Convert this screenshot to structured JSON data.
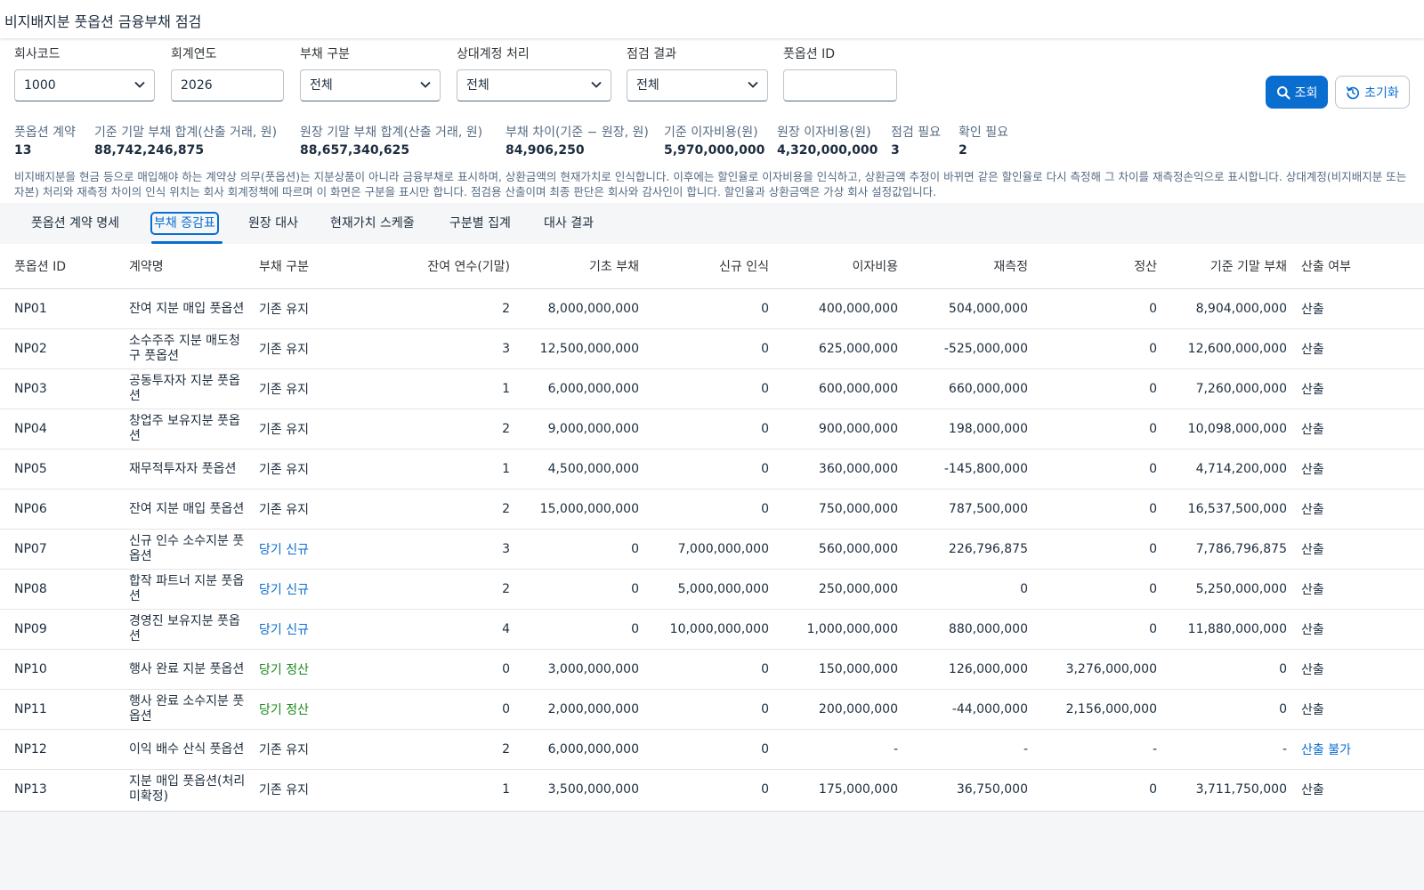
{
  "app": {
    "title": "비지배지분 풋옵션 금융부채 점검"
  },
  "filters": {
    "company": {
      "label": "회사코드",
      "value": "1000"
    },
    "year": {
      "label": "회계연도",
      "value": "2026"
    },
    "category": {
      "label": "부채 구분",
      "value": "전체"
    },
    "counter": {
      "label": "상대계정 처리",
      "value": "전체"
    },
    "result": {
      "label": "점검 결과",
      "value": "전체"
    },
    "putid": {
      "label": "풋옵션 ID",
      "value": ""
    }
  },
  "buttons": {
    "search": "조회",
    "reset": "초기화"
  },
  "kpis": [
    {
      "label": "풋옵션 계약",
      "value": "13"
    },
    {
      "label": "기준 기말 부채 합계(산출 거래, 원)",
      "value": "88,742,246,875"
    },
    {
      "label": "원장 기말 부채 합계(산출 거래, 원)",
      "value": "88,657,340,625"
    },
    {
      "label": "부채 차이(기준 − 원장, 원)",
      "value": "84,906,250"
    },
    {
      "label": "기준 이자비용(원)",
      "value": "5,970,000,000"
    },
    {
      "label": "원장 이자비용(원)",
      "value": "4,320,000,000"
    },
    {
      "label": "점검 필요",
      "value": "3"
    },
    {
      "label": "확인 필요",
      "value": "2"
    }
  ],
  "notice": "비지배지분을 현금 등으로 매입해야 하는 계약상 의무(풋옵션)는 지분상품이 아니라 금융부채로 표시하며, 상환금액의 현재가치로 인식합니다. 이후에는 할인율로 이자비용을 인식하고, 상환금액 추정이 바뀌면 같은 할인율로 다시 측정해 그 차이를 재측정손익으로 표시합니다. 상대계정(비지배지분 또는 자본) 처리와 재측정 차이의 인식 위치는 회사 회계정책에 따르며 이 화면은 구분을 표시만 합니다. 점검용 산출이며 최종 판단은 회사와 감사인이 합니다. 할인율과 상환금액은 가상 회사 설정값입니다.",
  "tabs": [
    "풋옵션 계약 명세",
    "부채 증감표",
    "원장 대사",
    "현재가치 스케줄",
    "구분별 집계",
    "대사 결과"
  ],
  "table": {
    "headers": [
      "풋옵션 ID",
      "계약명",
      "부채 구분",
      "잔여 연수(기말)",
      "기초 부채",
      "신규 인식",
      "이자비용",
      "재측정",
      "정산",
      "기준 기말 부채",
      "산출 여부"
    ],
    "rows": [
      {
        "id": "NP01",
        "name": "잔여 지분 매입 풋옵션",
        "cat": "기존 유지",
        "catType": "keep",
        "years": "2",
        "open": "8,000,000,000",
        "newrec": "0",
        "interest": "400,000,000",
        "remeas": "504,000,000",
        "settle": "0",
        "close": "8,904,000,000",
        "out": "산출",
        "outType": "ok"
      },
      {
        "id": "NP02",
        "name": "소수주주 지분 매도청구 풋옵션",
        "cat": "기존 유지",
        "catType": "keep",
        "years": "3",
        "open": "12,500,000,000",
        "newrec": "0",
        "interest": "625,000,000",
        "remeas": "-525,000,000",
        "settle": "0",
        "close": "12,600,000,000",
        "out": "산출",
        "outType": "ok"
      },
      {
        "id": "NP03",
        "name": "공동투자자 지분 풋옵션",
        "cat": "기존 유지",
        "catType": "keep",
        "years": "1",
        "open": "6,000,000,000",
        "newrec": "0",
        "interest": "600,000,000",
        "remeas": "660,000,000",
        "settle": "0",
        "close": "7,260,000,000",
        "out": "산출",
        "outType": "ok"
      },
      {
        "id": "NP04",
        "name": "창업주 보유지분 풋옵션",
        "cat": "기존 유지",
        "catType": "keep",
        "years": "2",
        "open": "9,000,000,000",
        "newrec": "0",
        "interest": "900,000,000",
        "remeas": "198,000,000",
        "settle": "0",
        "close": "10,098,000,000",
        "out": "산출",
        "outType": "ok"
      },
      {
        "id": "NP05",
        "name": "재무적투자자 풋옵션",
        "cat": "기존 유지",
        "catType": "keep",
        "years": "1",
        "open": "4,500,000,000",
        "newrec": "0",
        "interest": "360,000,000",
        "remeas": "-145,800,000",
        "settle": "0",
        "close": "4,714,200,000",
        "out": "산출",
        "outType": "ok"
      },
      {
        "id": "NP06",
        "name": "잔여 지분 매입 풋옵션",
        "cat": "기존 유지",
        "catType": "keep",
        "years": "2",
        "open": "15,000,000,000",
        "newrec": "0",
        "interest": "750,000,000",
        "remeas": "787,500,000",
        "settle": "0",
        "close": "16,537,500,000",
        "out": "산출",
        "outType": "ok"
      },
      {
        "id": "NP07",
        "name": "신규 인수 소수지분 풋옵션",
        "cat": "당기 신규",
        "catType": "new",
        "years": "3",
        "open": "0",
        "newrec": "7,000,000,000",
        "interest": "560,000,000",
        "remeas": "226,796,875",
        "settle": "0",
        "close": "7,786,796,875",
        "out": "산출",
        "outType": "ok"
      },
      {
        "id": "NP08",
        "name": "합작 파트너 지분 풋옵션",
        "cat": "당기 신규",
        "catType": "new",
        "years": "2",
        "open": "0",
        "newrec": "5,000,000,000",
        "interest": "250,000,000",
        "remeas": "0",
        "settle": "0",
        "close": "5,250,000,000",
        "out": "산출",
        "outType": "ok"
      },
      {
        "id": "NP09",
        "name": "경영진 보유지분 풋옵션",
        "cat": "당기 신규",
        "catType": "new",
        "years": "4",
        "open": "0",
        "newrec": "10,000,000,000",
        "interest": "1,000,000,000",
        "remeas": "880,000,000",
        "settle": "0",
        "close": "11,880,000,000",
        "out": "산출",
        "outType": "ok"
      },
      {
        "id": "NP10",
        "name": "행사 완료 지분 풋옵션",
        "cat": "당기 정산",
        "catType": "settle",
        "years": "0",
        "open": "3,000,000,000",
        "newrec": "0",
        "interest": "150,000,000",
        "remeas": "126,000,000",
        "settle": "3,276,000,000",
        "close": "0",
        "out": "산출",
        "outType": "ok"
      },
      {
        "id": "NP11",
        "name": "행사 완료 소수지분 풋옵션",
        "cat": "당기 정산",
        "catType": "settle",
        "years": "0",
        "open": "2,000,000,000",
        "newrec": "0",
        "interest": "200,000,000",
        "remeas": "-44,000,000",
        "settle": "2,156,000,000",
        "close": "0",
        "out": "산출",
        "outType": "ok"
      },
      {
        "id": "NP12",
        "name": "이익 배수 산식 풋옵션",
        "cat": "기존 유지",
        "catType": "keep",
        "years": "2",
        "open": "6,000,000,000",
        "newrec": "0",
        "interest": "-",
        "remeas": "-",
        "settle": "-",
        "close": "-",
        "out": "산출 불가",
        "outType": "fail"
      },
      {
        "id": "NP13",
        "name": "지분 매입 풋옵션(처리 미확정)",
        "cat": "기존 유지",
        "catType": "keep",
        "years": "1",
        "open": "3,500,000,000",
        "newrec": "0",
        "interest": "175,000,000",
        "remeas": "36,750,000",
        "settle": "0",
        "close": "3,711,750,000",
        "out": "산출",
        "outType": "ok"
      }
    ]
  },
  "colors": {
    "accent": "#0a6ed1",
    "settle": "#188918",
    "text": "#1d2d3e"
  },
  "icons": {
    "search": "search-icon",
    "reset": "reset-icon",
    "chevron": "chevron-down-icon"
  }
}
